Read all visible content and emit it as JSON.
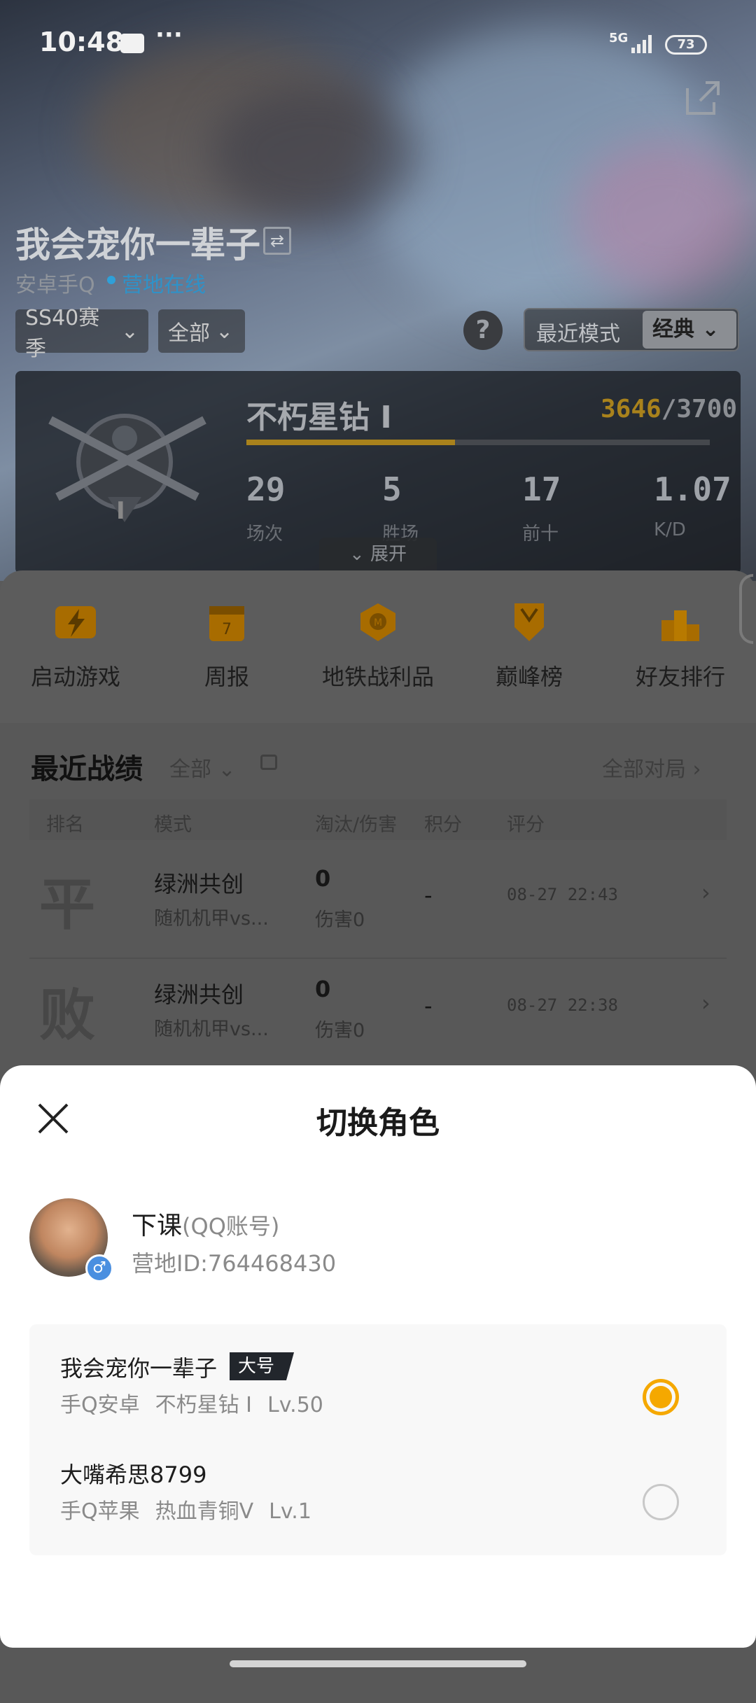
{
  "status_bar": {
    "time": "10:48",
    "message_icon": "message-icon",
    "more": "···",
    "network": "5G",
    "battery": "73"
  },
  "profile": {
    "name": "我会宠你一辈子",
    "platform": "安卓手Q",
    "online": "营地在线",
    "season": "SS40赛季",
    "scope": "全部",
    "recent_mode_label": "最近模式",
    "recent_mode_value": "经典"
  },
  "rank": {
    "tier": "不朽星钻 Ⅰ",
    "points_current": "3646",
    "points_total": "/3700",
    "progress": 0.45,
    "badge_level": "I",
    "expand": "展开",
    "stats": [
      {
        "value": "29",
        "label": "场次"
      },
      {
        "value": "5",
        "label": "胜场"
      },
      {
        "value": "17",
        "label": "前十"
      },
      {
        "value": "1.07",
        "label": "K/D"
      }
    ]
  },
  "quick_actions": [
    {
      "label": "启动游戏",
      "icon": "lightning-icon"
    },
    {
      "label": "周报",
      "icon": "calendar-icon"
    },
    {
      "label": "地铁战利品",
      "icon": "metro-badge-icon"
    },
    {
      "label": "巅峰榜",
      "icon": "trophy-shield-icon"
    },
    {
      "label": "好友排行",
      "icon": "podium-icon"
    }
  ],
  "recent": {
    "title": "最近战绩",
    "filter": "全部",
    "all_link": "全部对局",
    "headers": [
      "排名",
      "模式",
      "淘汰/伤害",
      "积分",
      "评分"
    ],
    "rows": [
      {
        "rank_char": "平",
        "mode": "绿洲共创",
        "sub": "随机机甲vs...",
        "kills": "0",
        "damage": "伤害0",
        "score": "-",
        "time": "08-27 22:43"
      },
      {
        "rank_char": "败",
        "mode": "绿洲共创",
        "sub": "随机机甲vs...",
        "kills": "0",
        "damage": "伤害0",
        "score": "-",
        "time": "08-27 22:38"
      }
    ]
  },
  "modal": {
    "title": "切换角色",
    "account_name": "下课",
    "account_type": "(QQ账号)",
    "camp_id": "营地ID:764468430",
    "roles": [
      {
        "name": "我会宠你一辈子",
        "tag": "大号",
        "platform": "手Q安卓",
        "rank": "不朽星钻 Ⅰ",
        "level": "Lv.50",
        "selected": true
      },
      {
        "name": "大嘴希思8799",
        "tag": "",
        "platform": "手Q苹果",
        "rank": "热血青铜Ⅴ",
        "level": "Lv.1",
        "selected": false
      }
    ]
  },
  "colors": {
    "accent": "#f5a800",
    "gold_text": "#b58a1c"
  }
}
